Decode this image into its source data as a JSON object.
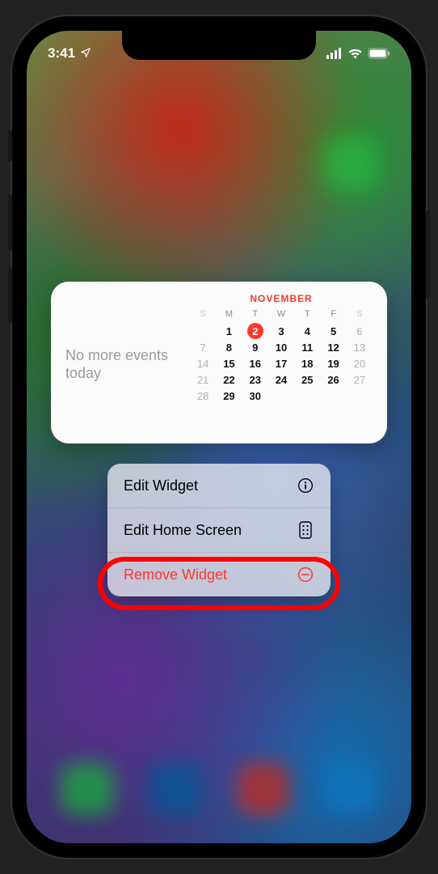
{
  "status": {
    "time": "3:41",
    "nav_icon": "➤"
  },
  "widget": {
    "no_events_text": "No more events today",
    "month": "NOVEMBER",
    "days_of_week": [
      "S",
      "M",
      "T",
      "W",
      "T",
      "F",
      "S"
    ],
    "today": 2,
    "weeks": [
      [
        "",
        "1",
        "2",
        "3",
        "4",
        "5",
        "6"
      ],
      [
        "7",
        "8",
        "9",
        "10",
        "11",
        "12",
        "13"
      ],
      [
        "14",
        "15",
        "16",
        "17",
        "18",
        "19",
        "20"
      ],
      [
        "21",
        "22",
        "23",
        "24",
        "25",
        "26",
        "27"
      ],
      [
        "28",
        "29",
        "30",
        "",
        "",
        "",
        ""
      ]
    ]
  },
  "menu": {
    "edit_widget": "Edit Widget",
    "edit_home_screen": "Edit Home Screen",
    "remove_widget": "Remove Widget"
  }
}
